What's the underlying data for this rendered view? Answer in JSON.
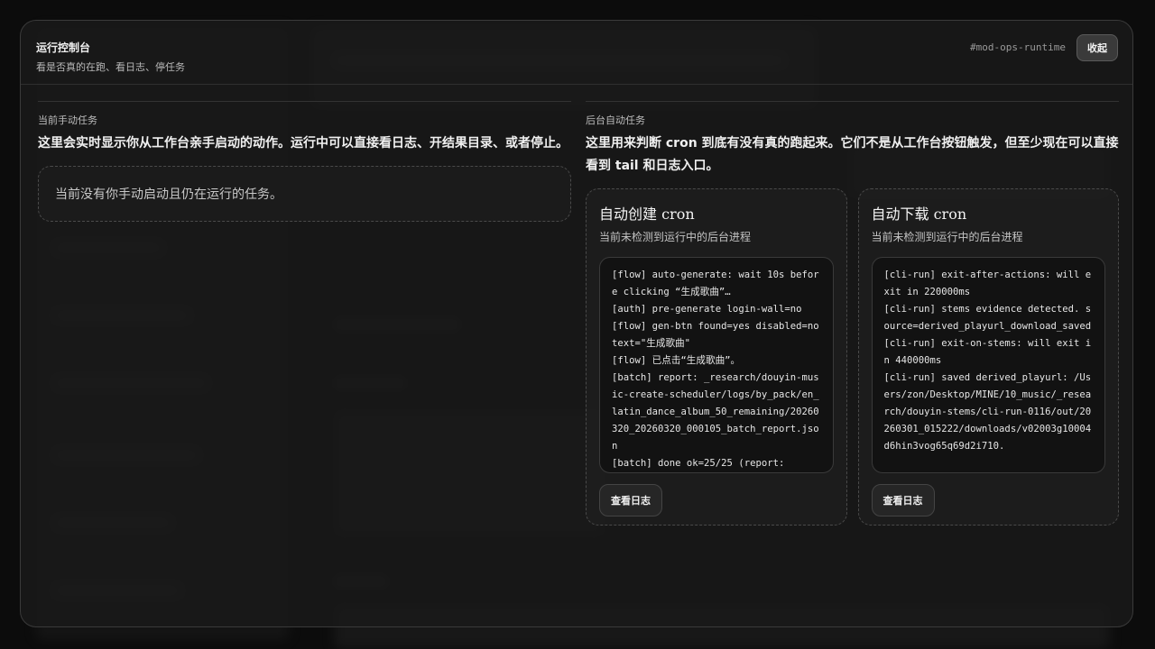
{
  "panel": {
    "title": "运行控制台",
    "subtitle": "看是否真的在跑、看日志、停任务",
    "id_tag": "#mod-ops-runtime",
    "collapse_label": "收起"
  },
  "manual": {
    "label": "当前手动任务",
    "description": "这里会实时显示你从工作台亲手启动的动作。运行中可以直接看日志、开结果目录、或者停止。",
    "empty_text": "当前没有你手动启动且仍在运行的任务。"
  },
  "background": {
    "label": "后台自动任务",
    "description": "这里用来判断 cron 到底有没有真的跑起来。它们不是从工作台按钮触发，但至少现在可以直接看到 tail 和日志入口。",
    "cards": [
      {
        "title": "自动创建 cron",
        "status": "当前未检测到运行中的后台进程",
        "log_lines": [
          "[flow] auto-generate: wait 10s before clicking “生成歌曲”…",
          "[auth] pre-generate login-wall=no",
          "[flow] gen-btn found=yes disabled=no text=\"生成歌曲\"",
          "[flow] 已点击“生成歌曲”。",
          "[batch] report: _research/douyin-music-create-scheduler/logs/by_pack/en_latin_dance_album_50_remaining/20260320_20260320_000105_batch_report.json",
          "[batch] done ok=25/25 (report:"
        ],
        "button_label": "查看日志"
      },
      {
        "title": "自动下载 cron",
        "status": "当前未检测到运行中的后台进程",
        "log_lines": [
          "[cli-run] exit-after-actions: will exit in 220000ms",
          "[cli-run] stems evidence detected. source=derived_playurl_download_saved",
          "[cli-run] exit-on-stems: will exit in 440000ms",
          "[cli-run] saved derived_playurl: /Users/zon/Desktop/MINE/10_music/_research/douyin-stems/cli-run-0116/out/20260301_015222/downloads/v02003g10004d6hin3vog65q69d2i710."
        ],
        "button_label": "查看日志"
      }
    ]
  }
}
